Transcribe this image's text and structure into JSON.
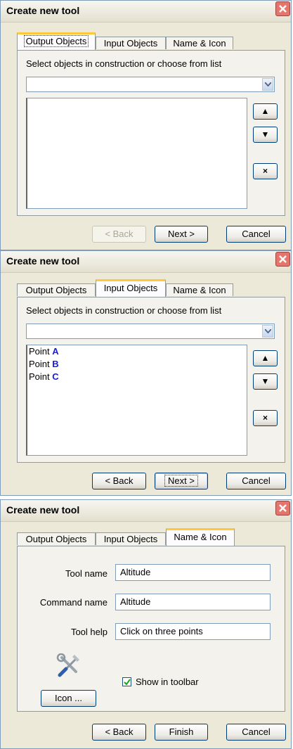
{
  "dialogs": [
    {
      "title": "Create new tool",
      "tabs": [
        "Output Objects",
        "Input Objects",
        "Name & Icon"
      ],
      "hint": "Select objects in construction or choose from list",
      "buttons": {
        "back": "< Back",
        "next": "Next >",
        "cancel": "Cancel"
      }
    },
    {
      "title": "Create new tool",
      "tabs": [
        "Output Objects",
        "Input Objects",
        "Name & Icon"
      ],
      "hint": "Select objects in construction or choose from list",
      "list": [
        {
          "prefix": "Point",
          "name": "A"
        },
        {
          "prefix": "Point",
          "name": "B"
        },
        {
          "prefix": "Point",
          "name": "C"
        }
      ],
      "buttons": {
        "back": "< Back",
        "next": "Next >",
        "cancel": "Cancel"
      }
    },
    {
      "title": "Create new tool",
      "tabs": [
        "Output Objects",
        "Input Objects",
        "Name & Icon"
      ],
      "fields": {
        "tool_name_label": "Tool name",
        "tool_name": "Altitude",
        "command_name_label": "Command name",
        "command_name": "Altitude",
        "tool_help_label": "Tool help",
        "tool_help": "Click on three points"
      },
      "show_in_toolbar": "Show in toolbar",
      "icon_button": "Icon ...",
      "buttons": {
        "back": "< Back",
        "finish": "Finish",
        "cancel": "Cancel"
      }
    }
  ],
  "side_buttons": {
    "up": "▲",
    "down": "▼",
    "remove": "×"
  }
}
